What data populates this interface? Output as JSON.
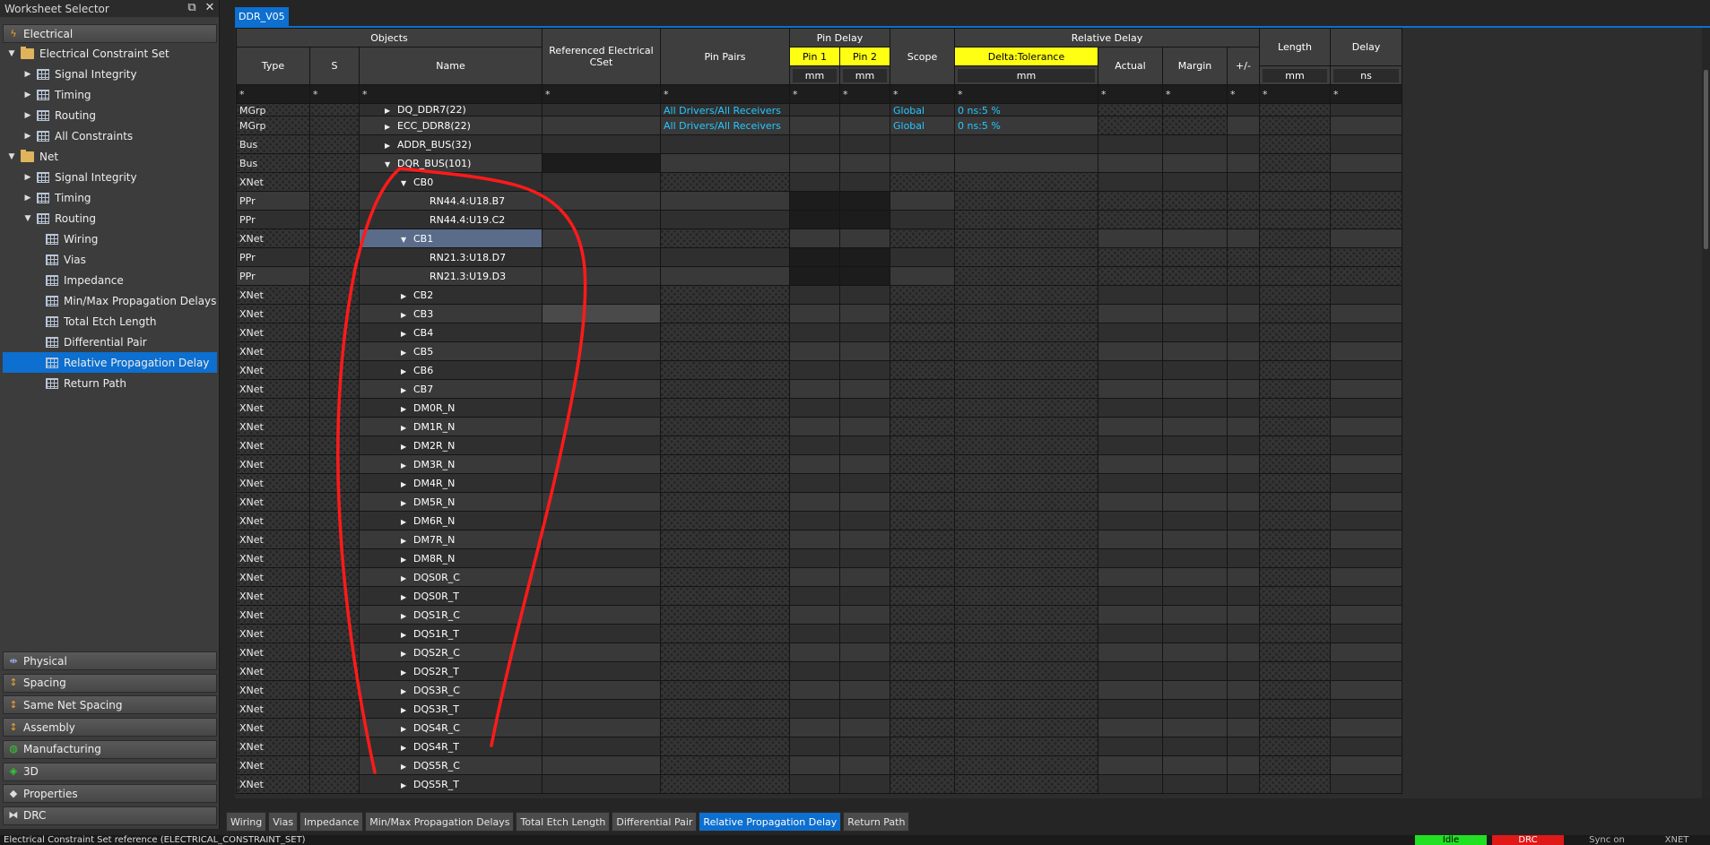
{
  "selector": {
    "title": "Worksheet Selector",
    "electrical_label": "Electrical",
    "tree": [
      {
        "label": "Electrical Constraint Set",
        "level": 0,
        "expanded": true,
        "icon": "folder-icon"
      },
      {
        "label": "Signal Integrity",
        "level": 1,
        "expanded": false,
        "icon": "worksheet-folder-icon"
      },
      {
        "label": "Timing",
        "level": 1,
        "expanded": false,
        "icon": "worksheet-folder-icon"
      },
      {
        "label": "Routing",
        "level": 1,
        "expanded": false,
        "icon": "worksheet-folder-icon"
      },
      {
        "label": "All Constraints",
        "level": 1,
        "expanded": false,
        "icon": "worksheet-folder-icon"
      },
      {
        "label": "Net",
        "level": 0,
        "expanded": true,
        "icon": "folder-icon"
      },
      {
        "label": "Signal Integrity",
        "level": 1,
        "expanded": false,
        "icon": "worksheet-folder-icon"
      },
      {
        "label": "Timing",
        "level": 1,
        "expanded": false,
        "icon": "worksheet-folder-icon"
      },
      {
        "label": "Routing",
        "level": 1,
        "expanded": true,
        "icon": "worksheet-folder-icon"
      },
      {
        "label": "Wiring",
        "level": 2,
        "icon": "grid-icon"
      },
      {
        "label": "Vias",
        "level": 2,
        "icon": "grid-icon"
      },
      {
        "label": "Impedance",
        "level": 2,
        "icon": "grid-icon"
      },
      {
        "label": "Min/Max Propagation Delays",
        "level": 2,
        "icon": "grid-icon"
      },
      {
        "label": "Total Etch Length",
        "level": 2,
        "icon": "grid-icon"
      },
      {
        "label": "Differential Pair",
        "level": 2,
        "icon": "grid-icon"
      },
      {
        "label": "Relative Propagation Delay",
        "level": 2,
        "icon": "grid-icon",
        "active": true
      },
      {
        "label": "Return Path",
        "level": 2,
        "icon": "grid-icon"
      }
    ],
    "categories": [
      "Physical",
      "Spacing",
      "Same Net Spacing",
      "Assembly",
      "Manufacturing",
      "3D",
      "Properties",
      "DRC"
    ]
  },
  "worksheet_tab": "DDR_V05",
  "headers": {
    "objects": "Objects",
    "type": "Type",
    "s": "S",
    "name": "Name",
    "ref_cset": "Referenced Electrical CSet",
    "pin_pairs": "Pin Pairs",
    "pin_delay": "Pin Delay",
    "pin1": "Pin 1",
    "pin2": "Pin 2",
    "scope": "Scope",
    "relative_delay": "Relative Delay",
    "delta_tol": "Delta:Tolerance",
    "actual": "Actual",
    "margin": "Margin",
    "plusminus": "+/-",
    "length": "Length",
    "delay": "Delay",
    "unit_mm": "mm",
    "unit_ns": "ns",
    "filter": "*"
  },
  "rows": [
    {
      "type": "MGrp",
      "name": "DQ_DDR7(22)",
      "depth": 1,
      "arrow": "right",
      "pin_pairs": "All Drivers/All Receivers",
      "scope": "Global",
      "delta": "0 ns:5 %",
      "partial": true
    },
    {
      "type": "MGrp",
      "name": "ECC_DDR8(22)",
      "depth": 1,
      "arrow": "right",
      "pin_pairs": "All Drivers/All Receivers",
      "scope": "Global",
      "delta": "0 ns:5 %"
    },
    {
      "type": "Bus",
      "name": "ADDR_BUS(32)",
      "depth": 1,
      "arrow": "right"
    },
    {
      "type": "Bus",
      "name": "DQR_BUS(101)",
      "depth": 1,
      "arrow": "down"
    },
    {
      "type": "XNet",
      "name": "CB0",
      "depth": 2,
      "arrow": "down"
    },
    {
      "type": "PPr",
      "name": "RN44.4:U18.B7",
      "depth": 3,
      "arrow": ""
    },
    {
      "type": "PPr",
      "name": "RN44.4:U19.C2",
      "depth": 3,
      "arrow": ""
    },
    {
      "type": "XNet",
      "name": "CB1",
      "depth": 2,
      "arrow": "down",
      "selected": true
    },
    {
      "type": "PPr",
      "name": "RN21.3:U18.D7",
      "depth": 3,
      "arrow": ""
    },
    {
      "type": "PPr",
      "name": "RN21.3:U19.D3",
      "depth": 3,
      "arrow": ""
    },
    {
      "type": "XNet",
      "name": "CB2",
      "depth": 2,
      "arrow": "right"
    },
    {
      "type": "XNet",
      "name": "CB3",
      "depth": 2,
      "arrow": "right"
    },
    {
      "type": "XNet",
      "name": "CB4",
      "depth": 2,
      "arrow": "right"
    },
    {
      "type": "XNet",
      "name": "CB5",
      "depth": 2,
      "arrow": "right"
    },
    {
      "type": "XNet",
      "name": "CB6",
      "depth": 2,
      "arrow": "right"
    },
    {
      "type": "XNet",
      "name": "CB7",
      "depth": 2,
      "arrow": "right"
    },
    {
      "type": "XNet",
      "name": "DM0R_N",
      "depth": 2,
      "arrow": "right"
    },
    {
      "type": "XNet",
      "name": "DM1R_N",
      "depth": 2,
      "arrow": "right"
    },
    {
      "type": "XNet",
      "name": "DM2R_N",
      "depth": 2,
      "arrow": "right"
    },
    {
      "type": "XNet",
      "name": "DM3R_N",
      "depth": 2,
      "arrow": "right"
    },
    {
      "type": "XNet",
      "name": "DM4R_N",
      "depth": 2,
      "arrow": "right"
    },
    {
      "type": "XNet",
      "name": "DM5R_N",
      "depth": 2,
      "arrow": "right"
    },
    {
      "type": "XNet",
      "name": "DM6R_N",
      "depth": 2,
      "arrow": "right"
    },
    {
      "type": "XNet",
      "name": "DM7R_N",
      "depth": 2,
      "arrow": "right"
    },
    {
      "type": "XNet",
      "name": "DM8R_N",
      "depth": 2,
      "arrow": "right"
    },
    {
      "type": "XNet",
      "name": "DQS0R_C",
      "depth": 2,
      "arrow": "right"
    },
    {
      "type": "XNet",
      "name": "DQS0R_T",
      "depth": 2,
      "arrow": "right"
    },
    {
      "type": "XNet",
      "name": "DQS1R_C",
      "depth": 2,
      "arrow": "right"
    },
    {
      "type": "XNet",
      "name": "DQS1R_T",
      "depth": 2,
      "arrow": "right"
    },
    {
      "type": "XNet",
      "name": "DQS2R_C",
      "depth": 2,
      "arrow": "right"
    },
    {
      "type": "XNet",
      "name": "DQS2R_T",
      "depth": 2,
      "arrow": "right"
    },
    {
      "type": "XNet",
      "name": "DQS3R_C",
      "depth": 2,
      "arrow": "right"
    },
    {
      "type": "XNet",
      "name": "DQS3R_T",
      "depth": 2,
      "arrow": "right"
    },
    {
      "type": "XNet",
      "name": "DQS4R_C",
      "depth": 2,
      "arrow": "right"
    },
    {
      "type": "XNet",
      "name": "DQS4R_T",
      "depth": 2,
      "arrow": "right"
    },
    {
      "type": "XNet",
      "name": "DQS5R_C",
      "depth": 2,
      "arrow": "right"
    },
    {
      "type": "XNet",
      "name": "DQS5R_T",
      "depth": 2,
      "arrow": "right"
    }
  ],
  "bottom_tabs": [
    {
      "label": "Wiring"
    },
    {
      "label": "Vias"
    },
    {
      "label": "Impedance"
    },
    {
      "label": "Min/Max Propagation Delays"
    },
    {
      "label": "Total Etch Length"
    },
    {
      "label": "Differential Pair"
    },
    {
      "label": "Relative Propagation Delay",
      "active": true
    },
    {
      "label": "Return Path"
    }
  ],
  "status": {
    "message": "Electrical Constraint Set reference (ELECTRICAL_CONSTRAINT_SET)",
    "idle": "Idle",
    "drc": "DRC",
    "sync": "Sync on",
    "xnet": "XNET"
  },
  "colors": {
    "accent": "#0d6fcf",
    "highlight_header": "#ffff14",
    "link_text": "#25c8ff",
    "annotation": "#ff1a1a",
    "status_idle": "#22e022",
    "status_drc": "#e01818"
  }
}
